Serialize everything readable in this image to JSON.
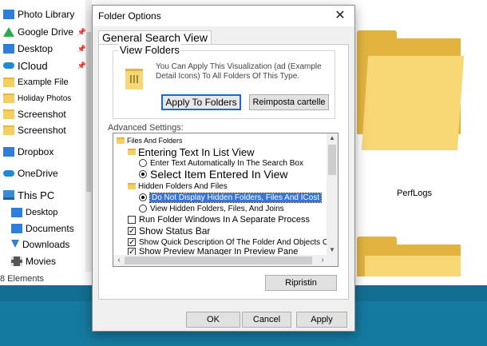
{
  "nav": {
    "items": [
      {
        "label": "Photo Library",
        "icon": "photo-library-icon"
      },
      {
        "label": "Google Drive",
        "icon": "google-drive-icon"
      },
      {
        "label": "Desktop",
        "icon": "desktop-icon"
      },
      {
        "label": "ICloud",
        "icon": "icloud-icon"
      },
      {
        "label": "Example File",
        "icon": "folder-icon"
      },
      {
        "label": "Holiday Photos",
        "icon": "folder-icon"
      },
      {
        "label": "Screenshot",
        "icon": "folder-icon"
      },
      {
        "label": "Screenshot",
        "icon": "folder-icon"
      },
      {
        "label": "Dropbox",
        "icon": "dropbox-icon"
      },
      {
        "label": "OneDrive",
        "icon": "onedrive-icon"
      },
      {
        "label": "This PC",
        "icon": "this-pc-icon"
      },
      {
        "label": "Desktop",
        "icon": "desktop-icon"
      },
      {
        "label": "Documents",
        "icon": "documents-icon"
      },
      {
        "label": "Downloads",
        "icon": "downloads-icon"
      },
      {
        "label": "Movies",
        "icon": "movies-icon"
      }
    ],
    "status": "8 Elements"
  },
  "content": {
    "folder_label": "PerfLogs"
  },
  "dialog": {
    "title": "Folder Options",
    "close_symbol": "✕",
    "tab_general": "General Search View",
    "view_folders": {
      "title": "View Folders",
      "description": "You Can Apply This Visualization (ad (Example Detail Icons) To All Folders Of This Type.",
      "apply_label": "Apply To Folders",
      "reset_label": "Reimposta cartelle"
    },
    "advanced_label": "Advanced Settings:",
    "tree": [
      {
        "kind": "folder",
        "label": "Files And Folders",
        "checked": false
      },
      {
        "kind": "folder",
        "label": "Entering Text In List View",
        "checked": false
      },
      {
        "kind": "radio",
        "label": "Enter Text Automatically In The Search Box",
        "checked": false
      },
      {
        "kind": "radio",
        "label": "Select Item Entered In View",
        "checked": true
      },
      {
        "kind": "folder",
        "label": "Hidden Folders And Files",
        "checked": false
      },
      {
        "kind": "radio",
        "label": "Do Not Display Hidden Folders, Files And ICost",
        "checked": true
      },
      {
        "kind": "radio",
        "label": "View Hidden Folders, Files, And Joins",
        "checked": false
      },
      {
        "kind": "check",
        "label": "Run Folder Windows In A Separate Process",
        "checked": false
      },
      {
        "kind": "check",
        "label": "Show Status Bar",
        "checked": true
      },
      {
        "kind": "check",
        "label": "Show Quick Description Of The Folder And Objects Of The",
        "checked": true
      },
      {
        "kind": "check",
        "label": "Show Preview Manager In Preview Pane",
        "checked": true
      }
    ],
    "restore_label": "Ripristin",
    "ok_label": "OK",
    "cancel_label": "Cancel",
    "apply_label": "Apply"
  },
  "colors": {
    "selection": "#3875d7",
    "folder_yellow": "#f8d775",
    "taskbar": "#157a9f"
  }
}
